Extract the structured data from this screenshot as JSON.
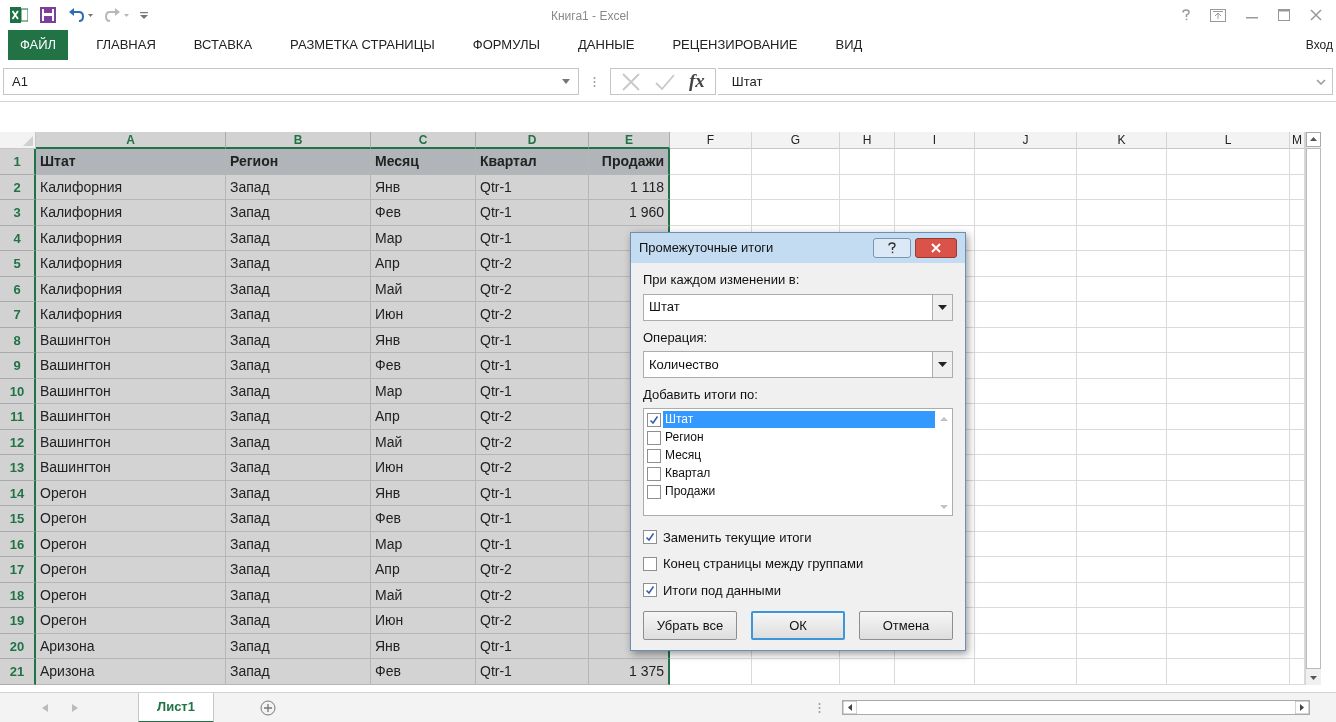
{
  "window": {
    "title": "Книга1 - Excel"
  },
  "ribbon": {
    "tabs": [
      {
        "label": "ФАЙЛ",
        "selected": false,
        "kind": "file"
      },
      {
        "label": "ГЛАВНАЯ",
        "selected": false,
        "kind": "tab"
      },
      {
        "label": "ВСТАВКА",
        "selected": false,
        "kind": "tab"
      },
      {
        "label": "РАЗМЕТКА СТРАНИЦЫ",
        "selected": false,
        "kind": "tab"
      },
      {
        "label": "ФОРМУЛЫ",
        "selected": false,
        "kind": "tab"
      },
      {
        "label": "ДАННЫЕ",
        "selected": false,
        "kind": "tab"
      },
      {
        "label": "РЕЦЕНЗИРОВАНИЕ",
        "selected": false,
        "kind": "tab"
      },
      {
        "label": "ВИД",
        "selected": false,
        "kind": "tab"
      }
    ],
    "sign_in": "Вход"
  },
  "formula_bar": {
    "name_box": "A1",
    "function_label": "fx",
    "value": "Штат"
  },
  "sheet": {
    "columns": [
      {
        "label": "A",
        "selected": true
      },
      {
        "label": "B",
        "selected": true
      },
      {
        "label": "C",
        "selected": true
      },
      {
        "label": "D",
        "selected": true
      },
      {
        "label": "E",
        "selected": true
      },
      {
        "label": "F",
        "selected": false
      },
      {
        "label": "G",
        "selected": false
      },
      {
        "label": "H",
        "selected": false
      },
      {
        "label": "I",
        "selected": false
      },
      {
        "label": "J",
        "selected": false
      },
      {
        "label": "K",
        "selected": false
      },
      {
        "label": "L",
        "selected": false
      },
      {
        "label": "M",
        "selected": false
      }
    ],
    "rows": [
      {
        "number": "1",
        "kind": "header",
        "selected": true,
        "cells": [
          "Штат",
          "Регион",
          "Месяц",
          "Квартал",
          "Продажи"
        ]
      },
      {
        "number": "2",
        "kind": "data",
        "selected": true,
        "cells": [
          "Калифорния",
          "Запад",
          "Янв",
          "Qtr-1",
          "1 118"
        ]
      },
      {
        "number": "3",
        "kind": "data",
        "selected": true,
        "cells": [
          "Калифорния",
          "Запад",
          "Фев",
          "Qtr-1",
          "1 960"
        ]
      },
      {
        "number": "4",
        "kind": "data",
        "selected": true,
        "cells": [
          "Калифорния",
          "Запад",
          "Мар",
          "Qtr-1"
        ]
      },
      {
        "number": "5",
        "kind": "data",
        "selected": true,
        "cells": [
          "Калифорния",
          "Запад",
          "Апр",
          "Qtr-2"
        ]
      },
      {
        "number": "6",
        "kind": "data",
        "selected": true,
        "cells": [
          "Калифорния",
          "Запад",
          "Май",
          "Qtr-2"
        ]
      },
      {
        "number": "7",
        "kind": "data",
        "selected": true,
        "cells": [
          "Калифорния",
          "Запад",
          "Июн",
          "Qtr-2"
        ]
      },
      {
        "number": "8",
        "kind": "data",
        "selected": true,
        "cells": [
          "Вашингтон",
          "Запад",
          "Янв",
          "Qtr-1"
        ]
      },
      {
        "number": "9",
        "kind": "data",
        "selected": true,
        "cells": [
          "Вашингтон",
          "Запад",
          "Фев",
          "Qtr-1"
        ]
      },
      {
        "number": "10",
        "kind": "data",
        "selected": true,
        "cells": [
          "Вашингтон",
          "Запад",
          "Мар",
          "Qtr-1"
        ]
      },
      {
        "number": "11",
        "kind": "data",
        "selected": true,
        "cells": [
          "Вашингтон",
          "Запад",
          "Апр",
          "Qtr-2"
        ]
      },
      {
        "number": "12",
        "kind": "data",
        "selected": true,
        "cells": [
          "Вашингтон",
          "Запад",
          "Май",
          "Qtr-2"
        ]
      },
      {
        "number": "13",
        "kind": "data",
        "selected": true,
        "cells": [
          "Вашингтон",
          "Запад",
          "Июн",
          "Qtr-2"
        ]
      },
      {
        "number": "14",
        "kind": "data",
        "selected": true,
        "cells": [
          "Орегон",
          "Запад",
          "Янв",
          "Qtr-1"
        ]
      },
      {
        "number": "15",
        "kind": "data",
        "selected": true,
        "cells": [
          "Орегон",
          "Запад",
          "Фев",
          "Qtr-1"
        ]
      },
      {
        "number": "16",
        "kind": "data",
        "selected": true,
        "cells": [
          "Орегон",
          "Запад",
          "Мар",
          "Qtr-1"
        ]
      },
      {
        "number": "17",
        "kind": "data",
        "selected": true,
        "cells": [
          "Орегон",
          "Запад",
          "Апр",
          "Qtr-2"
        ]
      },
      {
        "number": "18",
        "kind": "data",
        "selected": true,
        "cells": [
          "Орегон",
          "Запад",
          "Май",
          "Qtr-2"
        ]
      },
      {
        "number": "19",
        "kind": "data",
        "selected": true,
        "cells": [
          "Орегон",
          "Запад",
          "Июн",
          "Qtr-2"
        ]
      },
      {
        "number": "20",
        "kind": "data",
        "selected": true,
        "cells": [
          "Аризона",
          "Запад",
          "Янв",
          "Qtr-1"
        ]
      },
      {
        "number": "21",
        "kind": "data",
        "selected": true,
        "cells": [
          "Аризона",
          "Запад",
          "Фев",
          "Qtr-1",
          "1 375"
        ]
      }
    ]
  },
  "sheet_tabs": [
    {
      "label": "Лист1",
      "selected": true
    }
  ],
  "dialog": {
    "title": "Промежуточные итоги",
    "group_by": {
      "label": "При каждом изменении в:",
      "value": "Штат"
    },
    "function": {
      "label": "Операция:",
      "value": "Количество"
    },
    "add_to": {
      "label": "Добавить итоги по:",
      "items": [
        {
          "label": "Штат",
          "checked": true,
          "selected": true
        },
        {
          "label": "Регион",
          "checked": false,
          "selected": false
        },
        {
          "label": "Месяц",
          "checked": false,
          "selected": false
        },
        {
          "label": "Квартал",
          "checked": false,
          "selected": false
        },
        {
          "label": "Продажи",
          "checked": false,
          "selected": false
        }
      ]
    },
    "options": [
      {
        "label": "Заменить текущие итоги",
        "checked": true
      },
      {
        "label": "Конец страницы между группами",
        "checked": false
      },
      {
        "label": "Итоги под данными",
        "checked": true
      }
    ],
    "buttons": [
      {
        "label": "Убрать все",
        "default": false
      },
      {
        "label": "ОК",
        "default": true
      },
      {
        "label": "Отмена",
        "default": false
      }
    ]
  }
}
